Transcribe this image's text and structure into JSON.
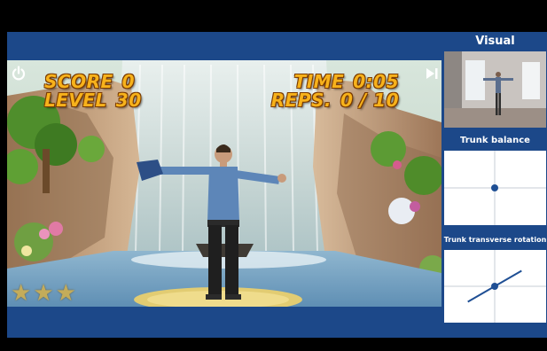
{
  "hud": {
    "score_label": "SCORE",
    "score_value": "0",
    "level_label": "LEVEL",
    "level_value": "30",
    "time_label": "TIME",
    "time_value": "0:05",
    "reps_label": "REPS.",
    "reps_value": "0 / 10"
  },
  "controls": {
    "power_icon": "power-icon",
    "skip_icon": "skip-forward-icon"
  },
  "stars": {
    "earned": 0,
    "total": 3
  },
  "side_panel": {
    "visual_title": "Visual",
    "balance_title": "Trunk balance",
    "rotation_title": "Trunk transverse rotation",
    "trunk_balance_point": {
      "x": 0.0,
      "y": 0.0
    },
    "trunk_rotation_line": {
      "angle_deg": 30
    }
  },
  "colors": {
    "frame": "#1c4889",
    "hud_text": "#f7b21b",
    "plot_marker": "#1f4f94"
  }
}
